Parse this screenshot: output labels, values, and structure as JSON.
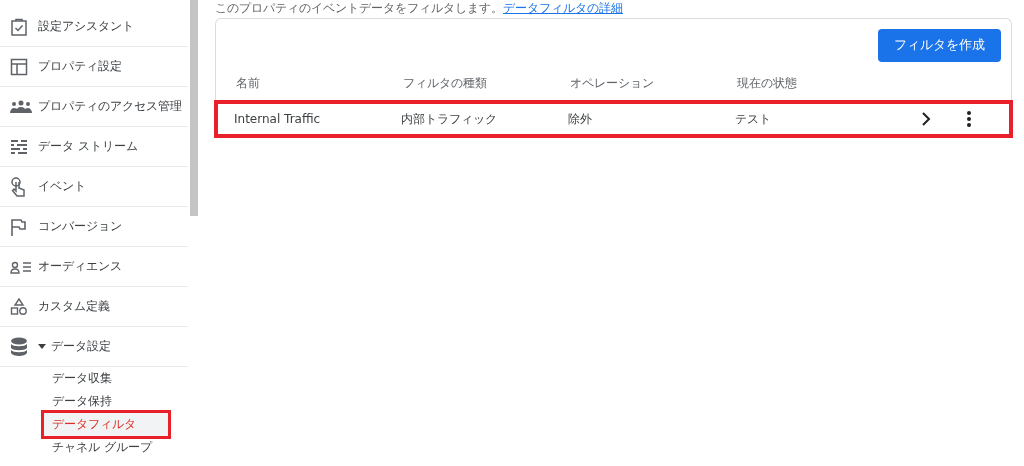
{
  "description": {
    "text": "このプロパティのイベントデータをフィルタします。",
    "link": "データフィルタの詳細"
  },
  "sidebar": {
    "items": [
      {
        "label": "設定アシスタント"
      },
      {
        "label": "プロパティ設定"
      },
      {
        "label": "プロパティのアクセス管理"
      },
      {
        "label": "データ ストリーム"
      },
      {
        "label": "イベント"
      },
      {
        "label": "コンバージョン"
      },
      {
        "label": "オーディエンス"
      },
      {
        "label": "カスタム定義"
      },
      {
        "label": "データ設定",
        "expanded": true,
        "children": [
          {
            "label": "データ収集",
            "selected": false,
            "highlighted": false
          },
          {
            "label": "データ保持",
            "selected": false,
            "highlighted": false
          },
          {
            "label": "データフィルタ",
            "selected": true,
            "highlighted": true
          },
          {
            "label": "チャネル グループ",
            "selected": false,
            "highlighted": false
          }
        ]
      }
    ]
  },
  "create_button": "フィルタを作成",
  "table": {
    "columns": [
      "名前",
      "フィルタの種類",
      "オペレーション",
      "現在の状態"
    ],
    "rows": [
      {
        "cells": [
          "Internal Traffic",
          "内部トラフィック",
          "除外",
          "テスト"
        ],
        "highlighted": true
      }
    ]
  }
}
